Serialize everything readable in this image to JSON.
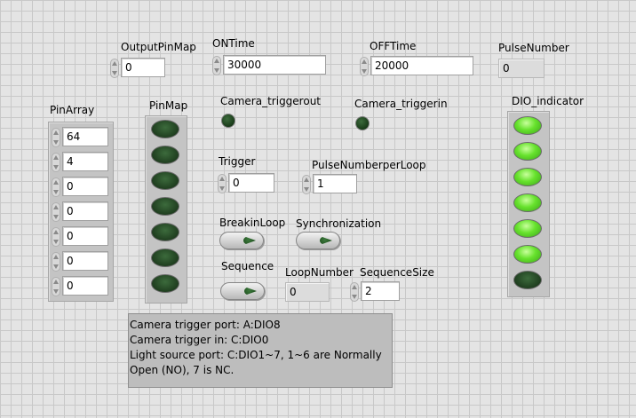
{
  "labels": {
    "output_pin_map": "OutputPinMap",
    "on_time": "ONTime",
    "off_time": "OFFTime",
    "pulse_number": "PulseNumber",
    "pin_array": "PinArray",
    "pin_map": "PinMap",
    "camera_triggerout": "Camera_triggerout",
    "camera_triggerin": "Camera_triggerin",
    "dio_indicator": "DIO_indicator",
    "trigger": "Trigger",
    "pulse_number_per_loop": "PulseNumberperLoop",
    "breakin_loop": "BreakinLoop",
    "synchronization": "Synchronization",
    "sequence": "Sequence",
    "loop_number": "LoopNumber",
    "sequence_size": "SequenceSize"
  },
  "values": {
    "output_pin_map": "0",
    "on_time": "30000",
    "off_time": "20000",
    "pulse_number": "0",
    "trigger": "0",
    "pulse_number_per_loop": "1",
    "loop_number": "0",
    "sequence_size": "2"
  },
  "pin_array": [
    "64",
    "4",
    "0",
    "0",
    "0",
    "0",
    "0"
  ],
  "pin_map_leds": [
    false,
    false,
    false,
    false,
    false,
    false,
    false
  ],
  "dio_indicator_leds": [
    true,
    true,
    true,
    true,
    true,
    true,
    false
  ],
  "camera_triggerout_on": false,
  "camera_triggerin_on": false,
  "note_lines": [
    "Camera trigger port: A:DIO8",
    "Camera trigger in: C:DIO0",
    "Light source port: C:DIO1~7, 1~6 are Normally",
    "Open (NO), 7 is  NC."
  ],
  "icons": [
    "spin-up-icon",
    "spin-down-icon",
    "led-icon",
    "button-light-icon"
  ],
  "colors": {
    "led_on": "#66e22c",
    "led_off": "#1f3e1f",
    "panel_bg": "#e4e4e4"
  }
}
